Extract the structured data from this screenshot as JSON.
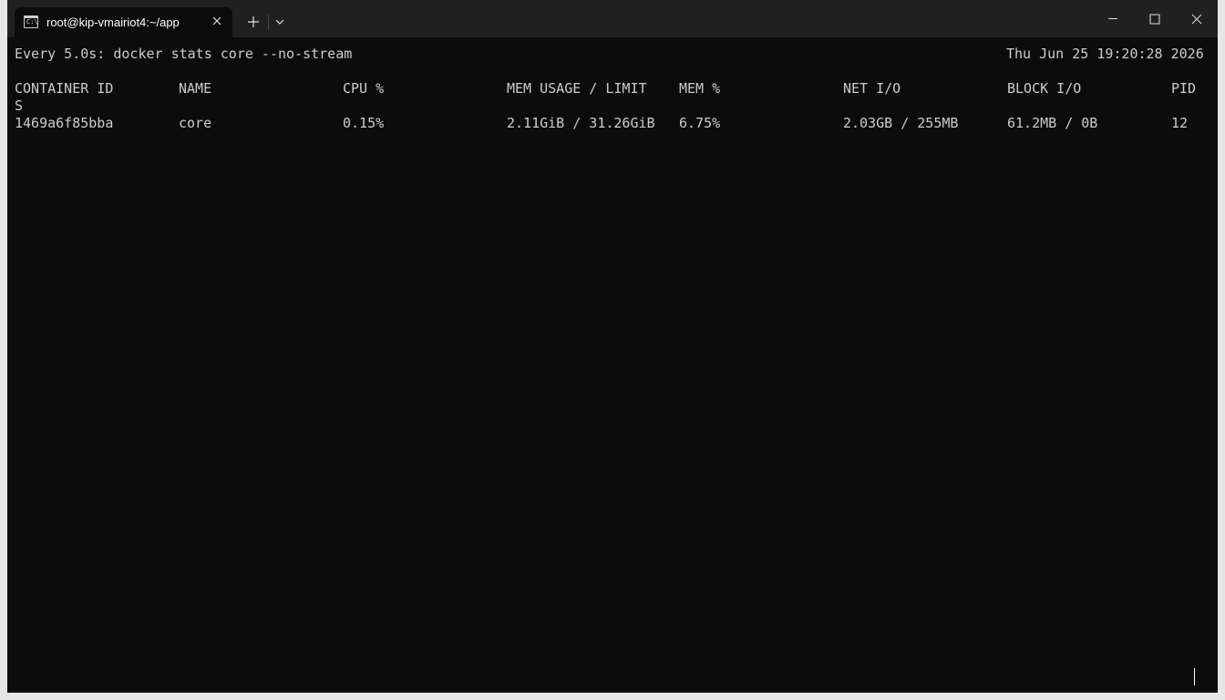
{
  "window": {
    "tab_title": "root@kip-vmairiot4:~/app",
    "tab_icon_text": "C:\\"
  },
  "terminal": {
    "header_command": "Every 5.0s: docker stats core --no-stream",
    "header_datetime": "Thu Jun 25 19:20:28 2026",
    "columns": [
      "CONTAINER ID",
      "NAME",
      "CPU %",
      "MEM USAGE / LIMIT",
      "MEM %",
      "NET I/O",
      "BLOCK I/O",
      "PID"
    ],
    "wrapped_header_char": "S",
    "rows": [
      {
        "container_id": "1469a6f85bba",
        "name": "core",
        "cpu": "0.15%",
        "mem_usage": "2.11GiB / 31.26GiB",
        "mem_pct": "6.75%",
        "net_io": "2.03GB / 255MB",
        "block_io": "61.2MB / 0B",
        "pids": "12"
      }
    ]
  },
  "colors": {
    "terminal_bg": "#0c0c0c",
    "titlebar_bg": "#202020",
    "text": "#cccccc"
  }
}
